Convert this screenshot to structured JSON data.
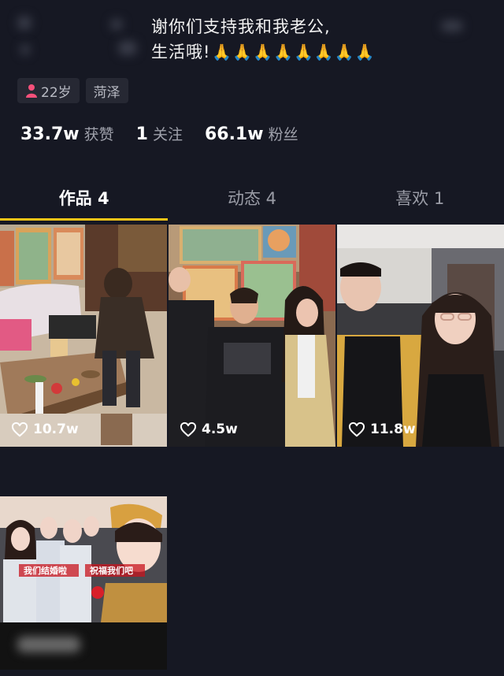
{
  "bio": {
    "line1": "谢你们支持我和我老公,",
    "line2": "生活哦!",
    "pray_emoji": "🙏🙏🙏🙏🙏🙏🙏🙏"
  },
  "tags": {
    "age": "22岁",
    "location": "菏泽"
  },
  "stats": {
    "likes": {
      "value": "33.7w",
      "label": "获赞"
    },
    "following": {
      "value": "1",
      "label": "关注"
    },
    "fans": {
      "value": "66.1w",
      "label": "粉丝"
    }
  },
  "tabs": [
    {
      "label": "作品 4",
      "active": true
    },
    {
      "label": "动态 4",
      "active": false
    },
    {
      "label": "喜欢 1",
      "active": false
    }
  ],
  "videos": [
    {
      "likes": "10.7w",
      "icon": "heart-outline-icon"
    },
    {
      "likes": "4.5w",
      "icon": "heart-outline-icon"
    },
    {
      "likes": "11.8w",
      "icon": "heart-outline-icon"
    },
    {
      "likes": "",
      "banner_left": "我们结婚啦",
      "banner_right": "祝福我们吧"
    }
  ],
  "colors": {
    "background": "#161823",
    "tab_indicator": "#f6c417",
    "tag_bg": "#262833",
    "accent_pink": "#f5507a"
  }
}
